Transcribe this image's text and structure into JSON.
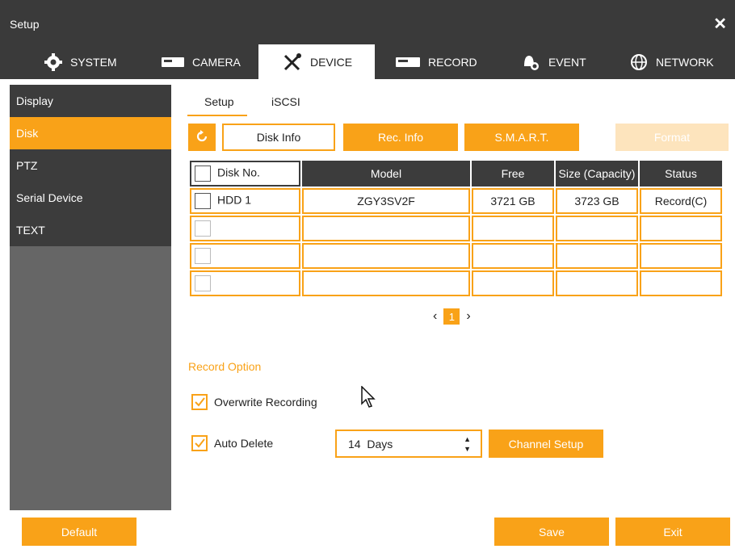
{
  "window": {
    "title": "Setup",
    "close": "✕"
  },
  "main_tabs": [
    {
      "label": "SYSTEM",
      "icon": "gear-icon"
    },
    {
      "label": "CAMERA",
      "icon": "camera-icon"
    },
    {
      "label": "DEVICE",
      "icon": "tools-icon",
      "active": true
    },
    {
      "label": "RECORD",
      "icon": "record-icon"
    },
    {
      "label": "EVENT",
      "icon": "bell-icon"
    },
    {
      "label": "NETWORK",
      "icon": "globe-icon"
    }
  ],
  "sidebar": {
    "items": [
      {
        "label": "Display"
      },
      {
        "label": "Disk",
        "active": true
      },
      {
        "label": "PTZ"
      },
      {
        "label": "Serial Device"
      },
      {
        "label": "TEXT"
      }
    ]
  },
  "subtabs": [
    {
      "label": "Setup",
      "active": true
    },
    {
      "label": "iSCSI"
    }
  ],
  "actions": {
    "refresh_icon": "refresh-icon",
    "disk_info": "Disk Info",
    "rec_info": "Rec. Info",
    "smart": "S.M.A.R.T.",
    "format": "Format"
  },
  "table": {
    "headers": [
      "Disk No.",
      "Model",
      "Free",
      "Size (Capacity)",
      "Status"
    ],
    "rows": [
      [
        "HDD 1",
        "ZGY3SV2F",
        "3721 GB",
        "3723 GB",
        "Record(C)"
      ],
      [
        "",
        "",
        "",
        "",
        ""
      ],
      [
        "",
        "",
        "",
        "",
        ""
      ],
      [
        "",
        "",
        "",
        "",
        ""
      ]
    ]
  },
  "pager": {
    "prev": "‹",
    "page": "1",
    "next": "›"
  },
  "record_option": {
    "title": "Record Option",
    "overwrite": {
      "label": "Overwrite Recording",
      "checked": true
    },
    "auto_delete": {
      "label": "Auto Delete",
      "checked": true,
      "value": "14  Days"
    },
    "channel_setup": "Channel Setup"
  },
  "footer": {
    "default": "Default",
    "save": "Save",
    "exit": "Exit"
  },
  "colors": {
    "accent": "#f9a218",
    "dark": "#3a3a3a",
    "sidebar_bg": "#666666"
  }
}
